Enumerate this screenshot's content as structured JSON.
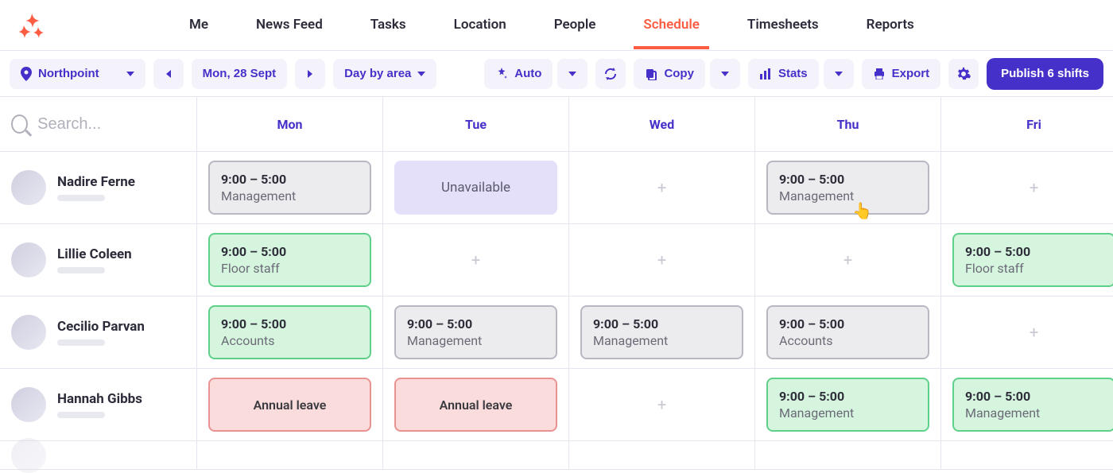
{
  "nav": {
    "items": [
      "Me",
      "News Feed",
      "Tasks",
      "Location",
      "People",
      "Schedule",
      "Timesheets",
      "Reports"
    ],
    "active": "Schedule"
  },
  "toolbar": {
    "location": "Northpoint",
    "date": "Mon, 28 Sept",
    "view": "Day by area",
    "auto": "Auto",
    "copy": "Copy",
    "stats": "Stats",
    "export": "Export",
    "publish": "Publish 6 shifts"
  },
  "search": {
    "placeholder": "Search..."
  },
  "days": [
    "Mon",
    "Tue",
    "Wed",
    "Thu",
    "Fri"
  ],
  "people": [
    {
      "name": "Nadire Ferne",
      "cells": [
        {
          "type": "shift",
          "status": "grey",
          "time": "9:00 – 5:00",
          "area": "Management"
        },
        {
          "type": "block",
          "status": "purple",
          "label": "Unavailable"
        },
        {
          "type": "add"
        },
        {
          "type": "shift",
          "status": "grey",
          "time": "9:00 – 5:00",
          "area": "Management",
          "hover": true
        },
        {
          "type": "add"
        }
      ]
    },
    {
      "name": "Lillie Coleen",
      "cells": [
        {
          "type": "shift",
          "status": "green",
          "time": "9:00 – 5:00",
          "area": "Floor staff"
        },
        {
          "type": "add"
        },
        {
          "type": "add"
        },
        {
          "type": "add"
        },
        {
          "type": "shift",
          "status": "green",
          "time": "9:00 – 5:00",
          "area": "Floor staff"
        }
      ]
    },
    {
      "name": "Cecilio Parvan",
      "cells": [
        {
          "type": "shift",
          "status": "green",
          "time": "9:00 – 5:00",
          "area": "Accounts"
        },
        {
          "type": "shift",
          "status": "grey",
          "time": "9:00 – 5:00",
          "area": "Management"
        },
        {
          "type": "shift",
          "status": "grey",
          "time": "9:00 – 5:00",
          "area": "Management"
        },
        {
          "type": "shift",
          "status": "grey",
          "time": "9:00 – 5:00",
          "area": "Accounts"
        },
        {
          "type": "add"
        }
      ]
    },
    {
      "name": "Hannah Gibbs",
      "cells": [
        {
          "type": "block",
          "status": "red",
          "label": "Annual leave"
        },
        {
          "type": "block",
          "status": "red",
          "label": "Annual leave"
        },
        {
          "type": "add"
        },
        {
          "type": "shift",
          "status": "green",
          "time": "9:00 – 5:00",
          "area": "Management"
        },
        {
          "type": "shift",
          "status": "green",
          "time": "9:00 – 5:00",
          "area": "Management"
        }
      ]
    }
  ]
}
